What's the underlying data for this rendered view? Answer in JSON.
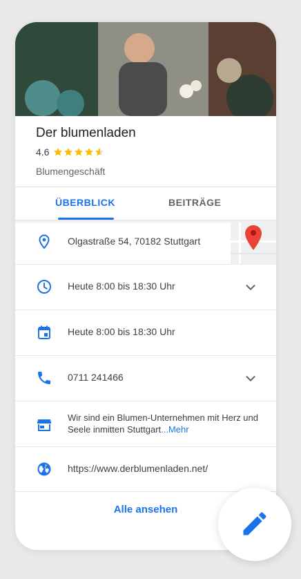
{
  "place": {
    "name": "Der blumenladen",
    "rating": "4.6",
    "stars": 4.6,
    "category": "Blumengeschäft"
  },
  "tabs": [
    {
      "label": "ÜBERBLICK",
      "active": true
    },
    {
      "label": "BEITRÄGE",
      "active": false
    }
  ],
  "info": {
    "address": "Olgastraße 54, 70182 Stuttgart",
    "hours": "Heute 8:00 bis 18:30 Uhr",
    "hours_calendar": "Heute 8:00 bis 18:30 Uhr",
    "phone": "0711 241466",
    "description": "Wir sind ein Blumen-Unternehmen mit Herz und Seele inmitten Stuttgart",
    "more_label": "...Mehr",
    "website": "https://www.derblumenladen.net/"
  },
  "actions": {
    "see_all": "Alle ansehen"
  },
  "colors": {
    "accent": "#1a73e8",
    "star": "#fbbc04",
    "pin": "#ea4335"
  },
  "icons": [
    "location-pin-icon",
    "clock-icon",
    "calendar-icon",
    "phone-icon",
    "storefront-icon",
    "globe-icon",
    "chevron-down-icon",
    "pencil-icon",
    "map-marker-icon"
  ]
}
